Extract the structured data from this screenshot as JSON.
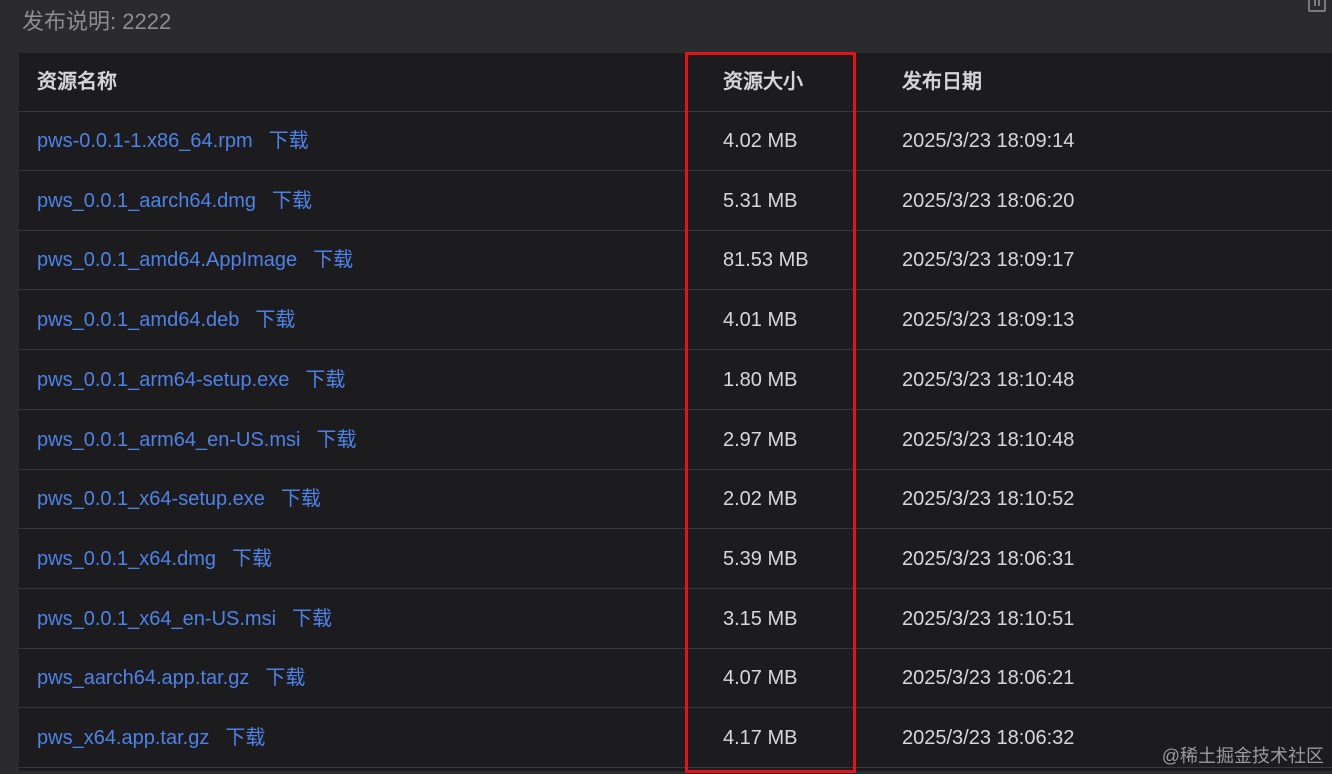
{
  "release_notes": {
    "label": "发布说明:",
    "value": "2222"
  },
  "table": {
    "headers": {
      "name": "资源名称",
      "size": "资源大小",
      "date": "发布日期"
    },
    "download_label": "下载",
    "rows": [
      {
        "name": "pws-0.0.1-1.x86_64.rpm",
        "size": "4.02 MB",
        "date": "2025/3/23 18:09:14"
      },
      {
        "name": "pws_0.0.1_aarch64.dmg",
        "size": "5.31 MB",
        "date": "2025/3/23 18:06:20"
      },
      {
        "name": "pws_0.0.1_amd64.AppImage",
        "size": "81.53 MB",
        "date": "2025/3/23 18:09:17"
      },
      {
        "name": "pws_0.0.1_amd64.deb",
        "size": "4.01 MB",
        "date": "2025/3/23 18:09:13"
      },
      {
        "name": "pws_0.0.1_arm64-setup.exe",
        "size": "1.80 MB",
        "date": "2025/3/23 18:10:48"
      },
      {
        "name": "pws_0.0.1_arm64_en-US.msi",
        "size": "2.97 MB",
        "date": "2025/3/23 18:10:48"
      },
      {
        "name": "pws_0.0.1_x64-setup.exe",
        "size": "2.02 MB",
        "date": "2025/3/23 18:10:52"
      },
      {
        "name": "pws_0.0.1_x64.dmg",
        "size": "5.39 MB",
        "date": "2025/3/23 18:06:31"
      },
      {
        "name": "pws_0.0.1_x64_en-US.msi",
        "size": "3.15 MB",
        "date": "2025/3/23 18:10:51"
      },
      {
        "name": "pws_aarch64.app.tar.gz",
        "size": "4.07 MB",
        "date": "2025/3/23 18:06:21"
      },
      {
        "name": "pws_x64.app.tar.gz",
        "size": "4.17 MB",
        "date": "2025/3/23 18:06:32"
      }
    ]
  },
  "highlight_color": "#e4121b",
  "link_color": "#4e82e6",
  "watermark": "@稀土掘金技术社区",
  "icons": {
    "corner": "trash-icon"
  }
}
